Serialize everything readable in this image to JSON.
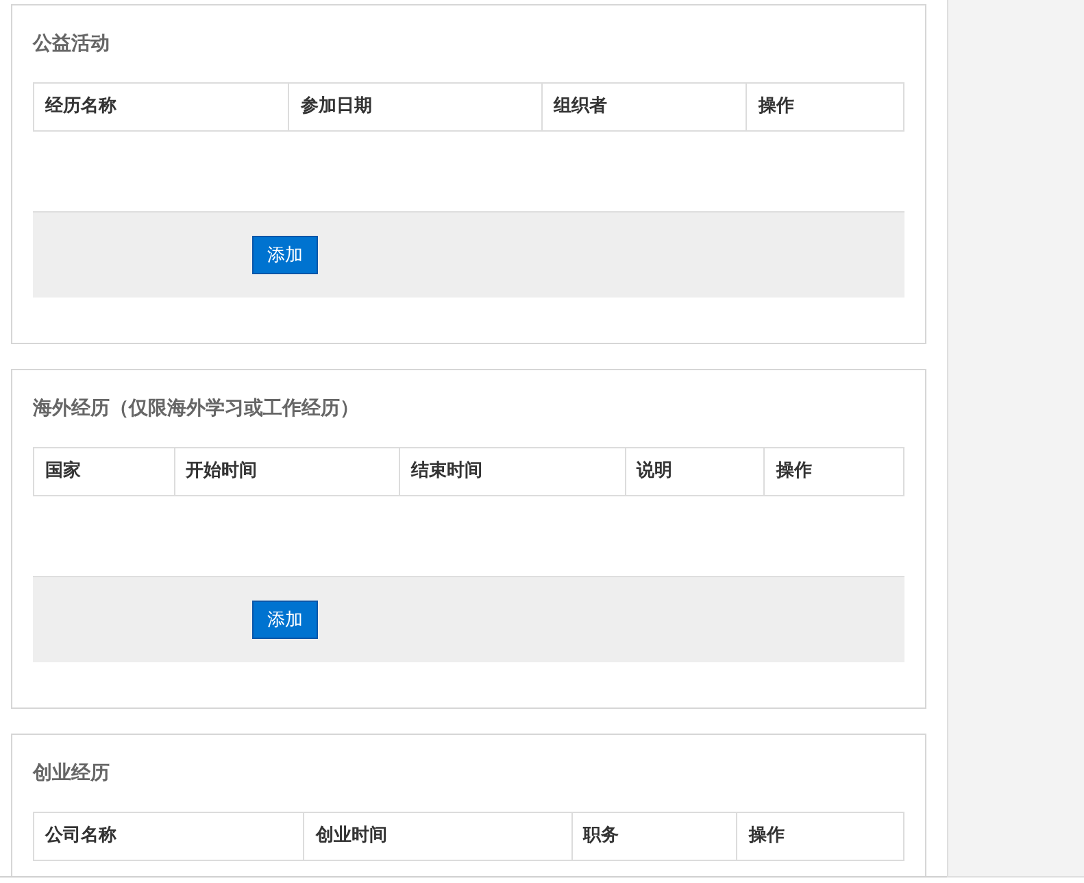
{
  "sections": [
    {
      "title": "公益活动",
      "columns": [
        "经历名称",
        "参加日期",
        "组织者",
        "操作"
      ],
      "add_button": "添加"
    },
    {
      "title": "海外经历（仅限海外学习或工作经历）",
      "columns": [
        "国家",
        "开始时间",
        "结束时间",
        "说明",
        "操作"
      ],
      "add_button": "添加"
    },
    {
      "title": "创业经历",
      "columns": [
        "公司名称",
        "创业时间",
        "职务",
        "操作"
      ]
    }
  ]
}
